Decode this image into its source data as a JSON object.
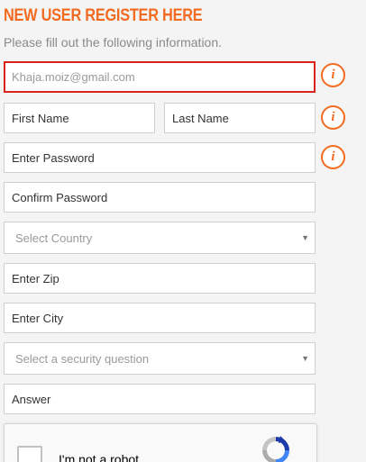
{
  "header": {
    "title": "NEW USER REGISTER HERE",
    "subtitle": "Please fill out the following information."
  },
  "form": {
    "email_value": "Khaja.moiz@gmail.com",
    "first_name_placeholder": "First Name",
    "last_name_placeholder": "Last Name",
    "password_placeholder": "Enter Password",
    "confirm_password_placeholder": "Confirm Password",
    "country_selected": "Select Country",
    "zip_placeholder": "Enter Zip",
    "city_placeholder": "Enter City",
    "security_question_selected": "Select a security question",
    "answer_placeholder": "Answer"
  },
  "info": {
    "glyph": "i"
  },
  "captcha": {
    "label": "I'm not a robot"
  },
  "colors": {
    "accent": "#f26b21",
    "error_border": "#d9231b",
    "background": "#f4f4f4",
    "field_border": "#cfcfcf"
  },
  "icons": {
    "info": "info-circle-icon",
    "caret": "caret-down-icon",
    "captcha_logo": "recaptcha-logo-icon"
  }
}
